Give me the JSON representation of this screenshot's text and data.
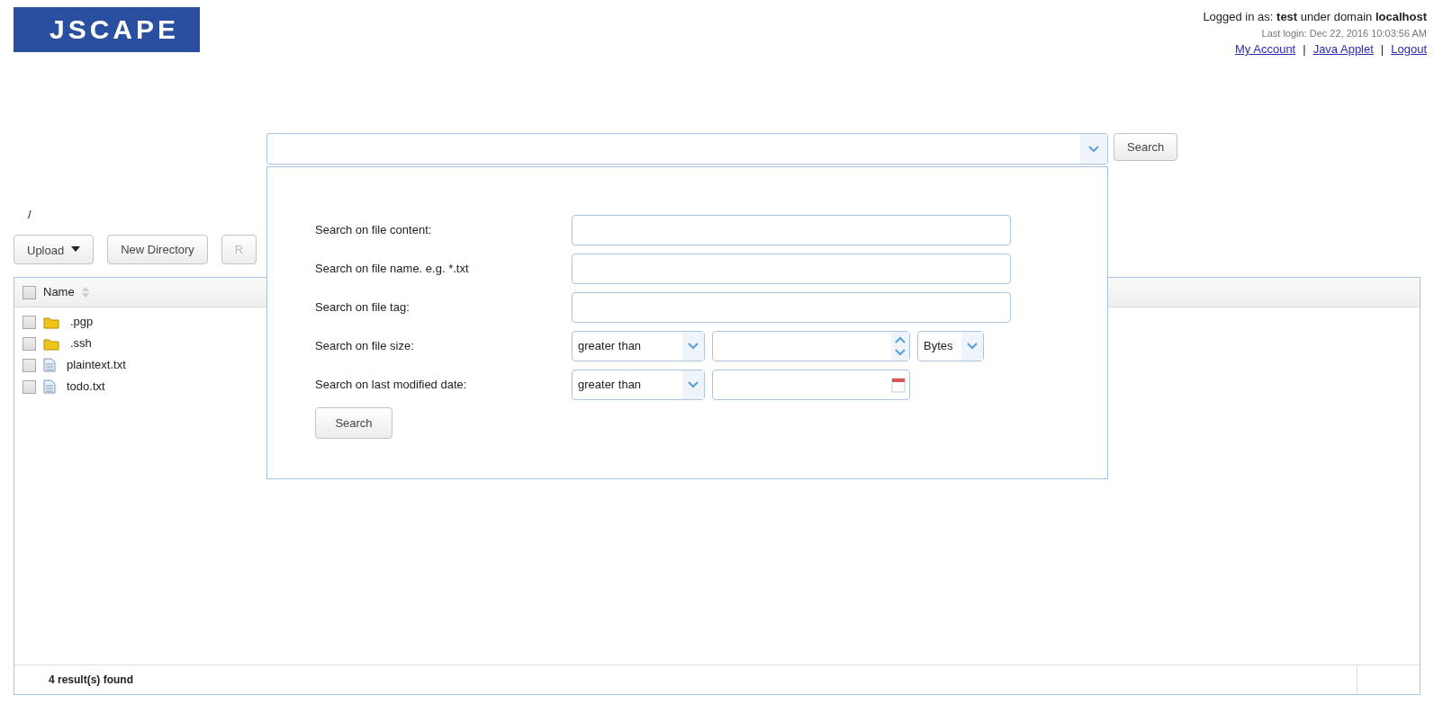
{
  "header": {
    "logo": "JSCAPE",
    "login_line": "Logged in as: **test** under domain **localhost**",
    "last_login": "Last login: Dec 22, 2016 10:03:56 AM",
    "links": [
      "My Account",
      "Java Applet",
      "Logout"
    ],
    "separator": "|"
  },
  "search": {
    "button": "Search",
    "expanded": true,
    "panel": {
      "rows": [
        {
          "kind": "text",
          "label": "Search on file content:"
        },
        {
          "kind": "text",
          "label": "Search on file name. e.g. *.txt"
        },
        {
          "kind": "text",
          "label": "Search on file tag:"
        },
        {
          "kind": "size",
          "label": "Search on file size:",
          "operator": "greater than",
          "unit": "Bytes"
        },
        {
          "kind": "date",
          "label": "Search on last modified date:",
          "operator": "greater than"
        }
      ],
      "button": "Search"
    }
  },
  "breadcrumb": "/",
  "toolbar": [
    {
      "label": "Upload",
      "kind": "dropdown",
      "disabled": false
    },
    {
      "label": "New Directory",
      "kind": "plain",
      "disabled": false
    },
    {
      "label": "R",
      "kind": "plain",
      "disabled": true
    }
  ],
  "table": {
    "columns": [
      {
        "label": "Name"
      }
    ],
    "all_checked": false,
    "rows": [
      {
        "name": ".pgp",
        "kind": "folder",
        "checked": false
      },
      {
        "name": ".ssh",
        "kind": "folder",
        "checked": false
      },
      {
        "name": "plaintext.txt",
        "kind": "file",
        "checked": false
      },
      {
        "name": "todo.txt",
        "kind": "file",
        "checked": false
      }
    ],
    "footer": "4 result(s) found"
  }
}
